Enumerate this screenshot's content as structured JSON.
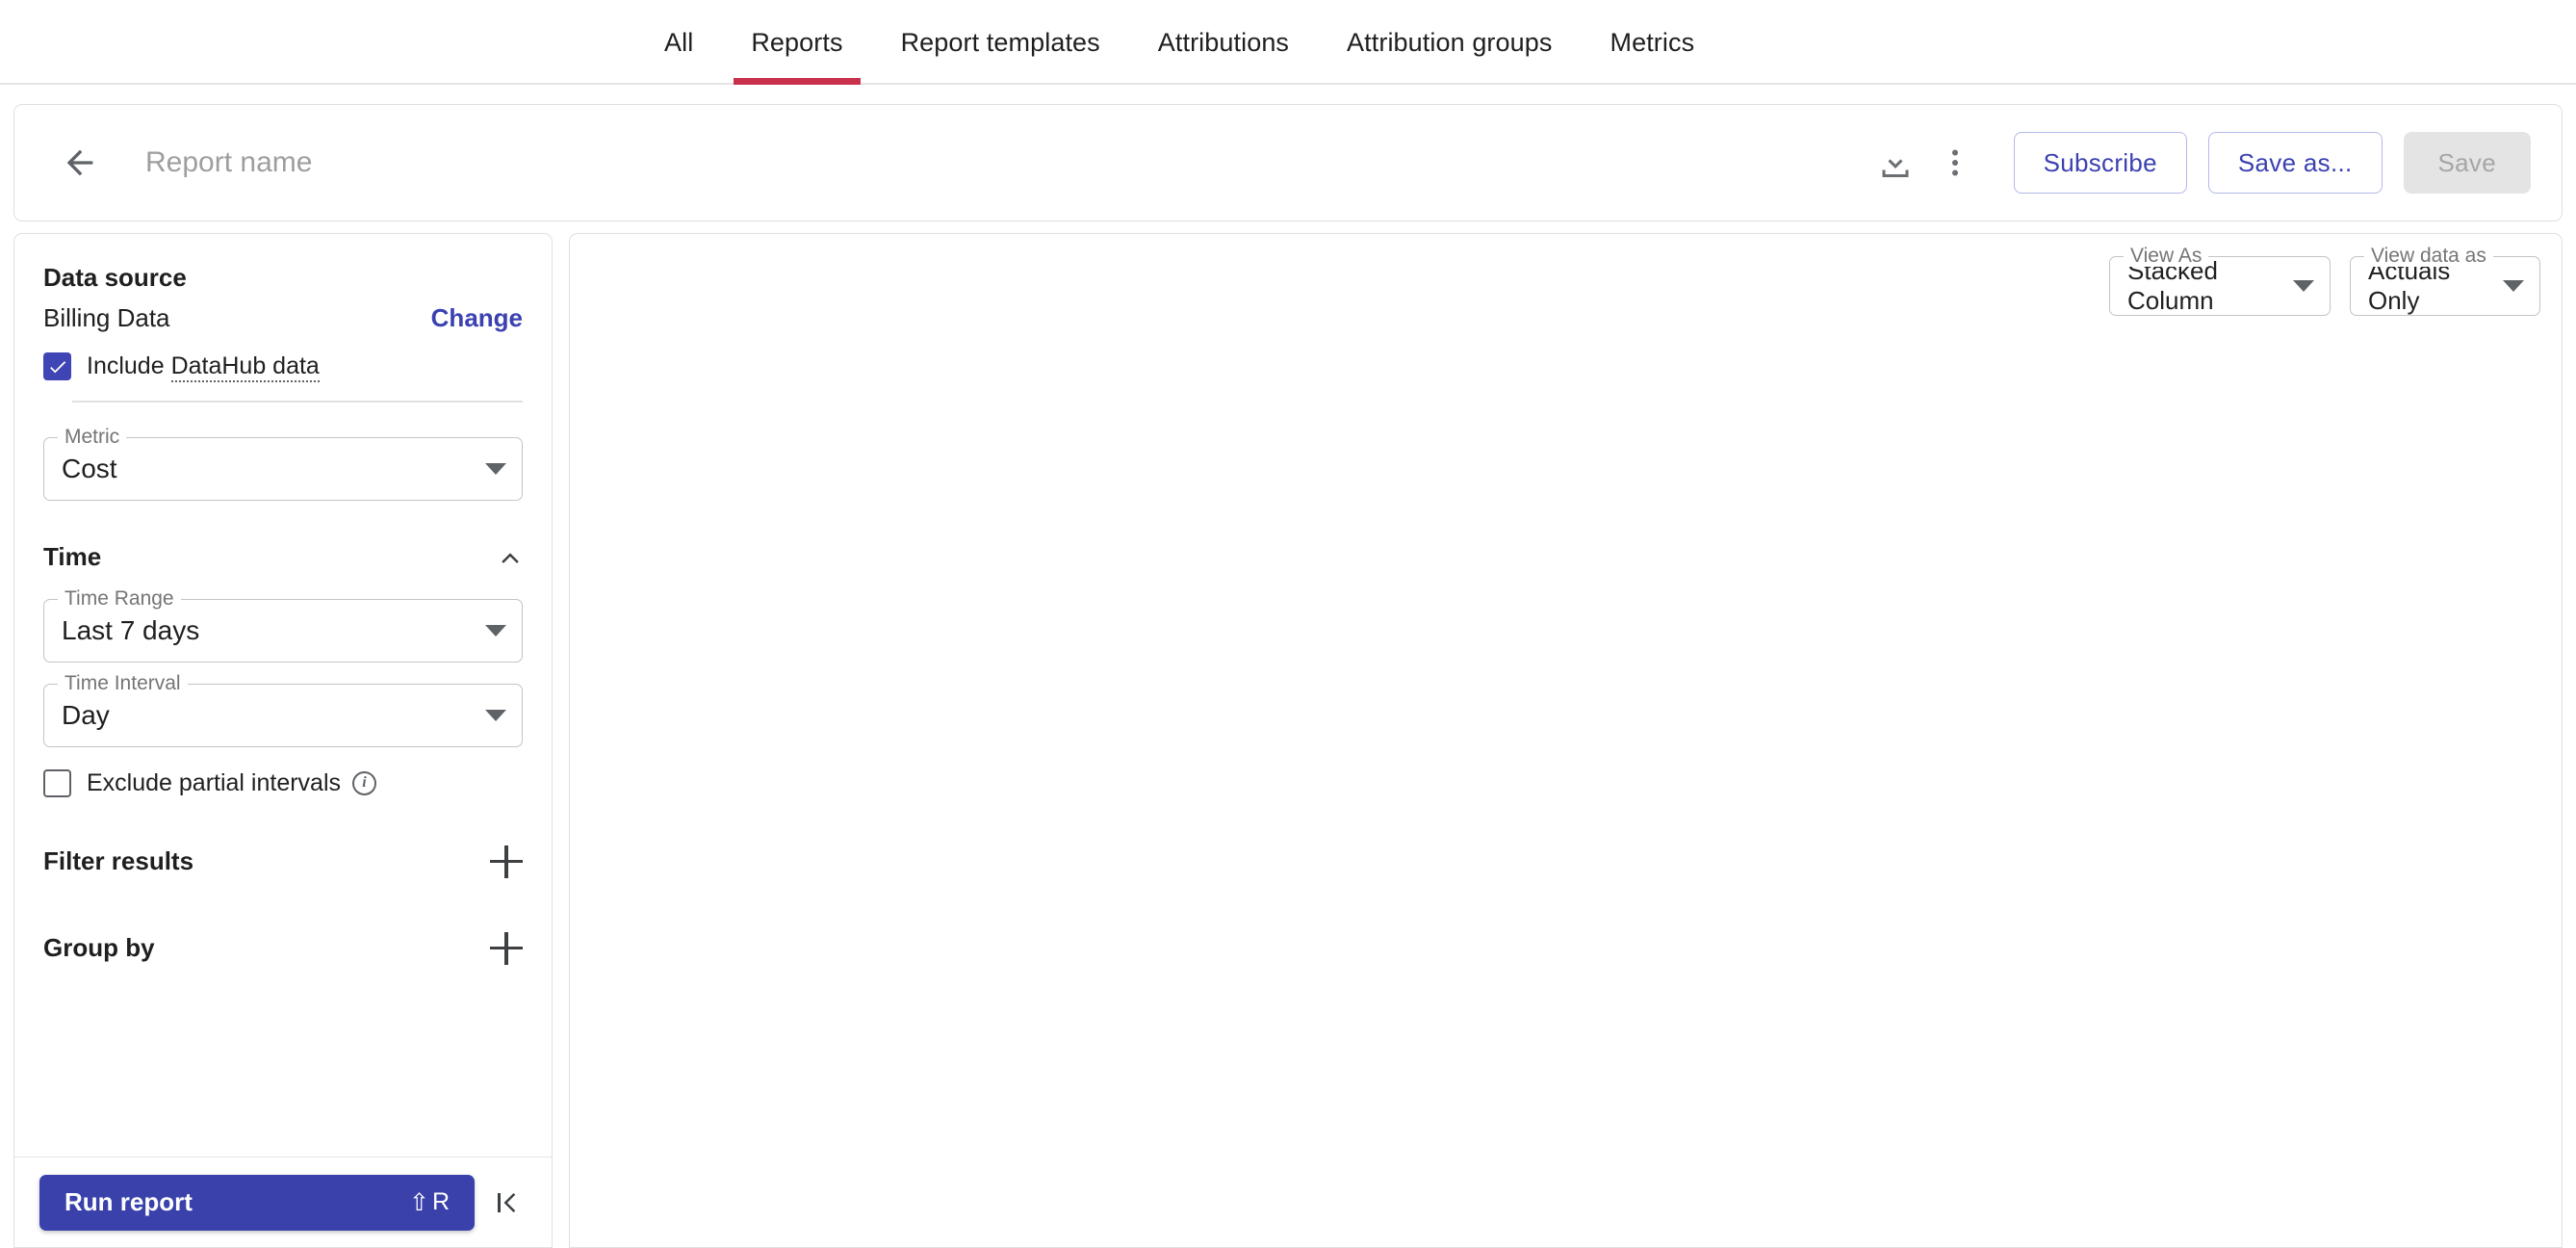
{
  "nav": {
    "tabs": [
      {
        "label": "All",
        "active": false
      },
      {
        "label": "Reports",
        "active": true
      },
      {
        "label": "Report templates",
        "active": false
      },
      {
        "label": "Attributions",
        "active": false
      },
      {
        "label": "Attribution groups",
        "active": false
      },
      {
        "label": "Metrics",
        "active": false
      }
    ],
    "active_underline_color": "#c8304c"
  },
  "toolbar": {
    "back_icon": "arrow-left-icon",
    "report_name_value": "",
    "report_name_placeholder": "Report name",
    "download_icon": "download-icon",
    "more_icon": "more-vertical-icon",
    "subscribe_label": "Subscribe",
    "save_as_label": "Save as...",
    "save_label": "Save",
    "accent_color": "#3b41b0"
  },
  "sidebar": {
    "data_source": {
      "title": "Data source",
      "name": "Billing Data",
      "change_label": "Change",
      "include_datahub": {
        "checked": true,
        "label_prefix": "Include ",
        "label_link": "DataHub data"
      }
    },
    "metric": {
      "legend": "Metric",
      "value": "Cost"
    },
    "time": {
      "title": "Time",
      "collapse_icon": "chevron-up-icon",
      "time_range": {
        "legend": "Time Range",
        "value": "Last 7 days"
      },
      "time_interval": {
        "legend": "Time Interval",
        "value": "Day"
      },
      "exclude_partial": {
        "checked": false,
        "label": "Exclude partial intervals",
        "info_icon": "info-icon",
        "info_glyph": "i"
      }
    },
    "filter_results": {
      "title": "Filter results",
      "add_icon": "plus-icon"
    },
    "group_by": {
      "title": "Group by",
      "add_icon": "plus-icon"
    },
    "footer": {
      "run_label": "Run report",
      "run_shortcut_modifier": "⇧",
      "run_shortcut_key": "R",
      "collapse_icon": "collapse-panel-icon",
      "run_button_color": "#3a41ab"
    }
  },
  "main": {
    "view_as": {
      "legend": "View As",
      "value": "Stacked Column"
    },
    "view_data_as": {
      "legend": "View data as",
      "value": "Actuals Only"
    }
  }
}
